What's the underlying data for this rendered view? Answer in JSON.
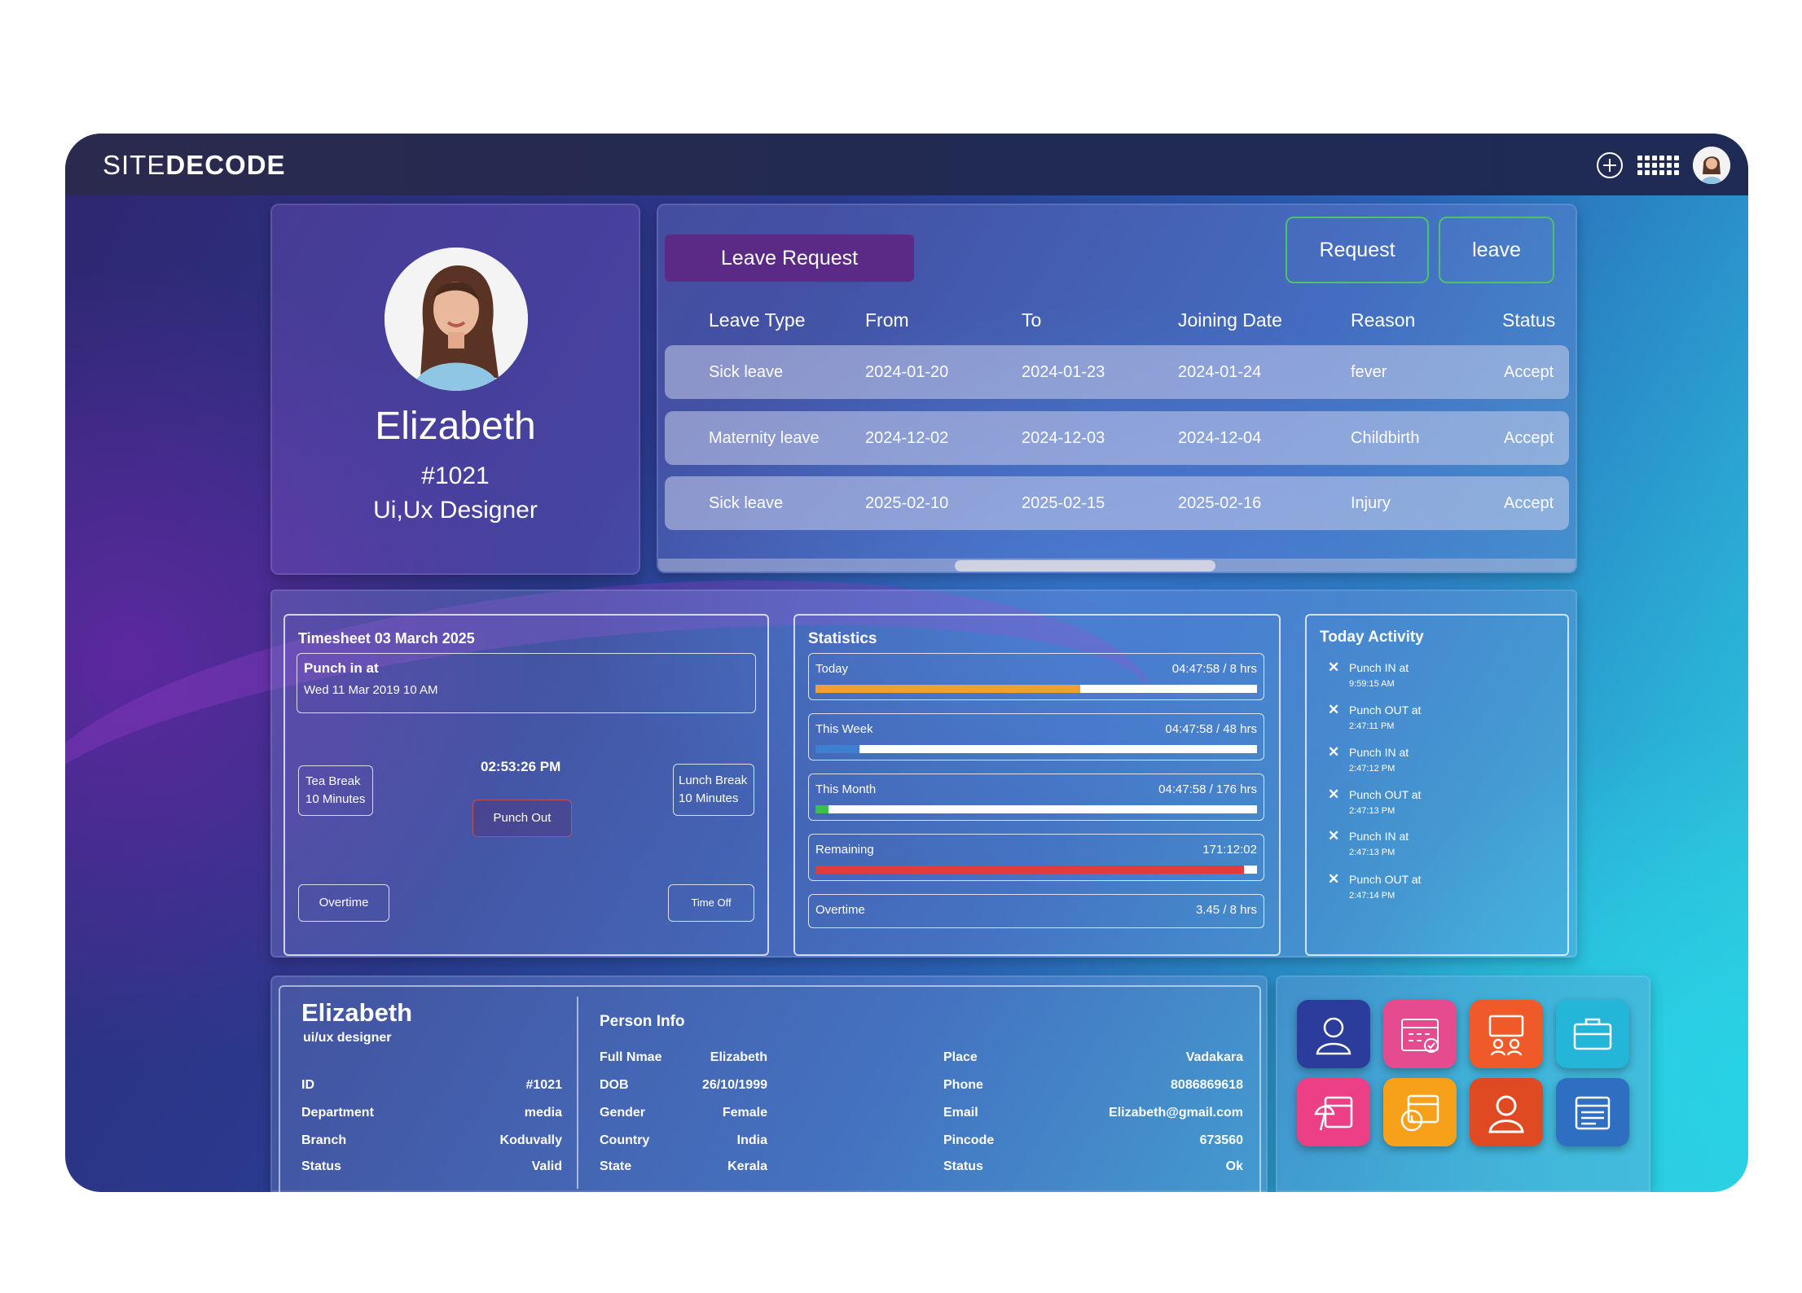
{
  "brand": {
    "prefix": "SITE",
    "suffix": "DECODE"
  },
  "profile": {
    "name": "Elizabeth",
    "id": "#1021",
    "role": "Ui,Ux Designer"
  },
  "leave": {
    "title": "Leave Request",
    "request_btn": "Request",
    "leave_btn": "leave",
    "headers": [
      "Leave Type",
      "From",
      "To",
      "Joining Date",
      "Reason",
      "Status"
    ],
    "rows": [
      [
        "Sick leave",
        "2024-01-20",
        "2024-01-23",
        "2024-01-24",
        "fever",
        "Accept"
      ],
      [
        "Maternity leave",
        "2024-12-02",
        "2024-12-03",
        "2024-12-04",
        "Childbirth",
        "Accept"
      ],
      [
        "Sick leave",
        "2025-02-10",
        "2025-02-15",
        "2025-02-16",
        "Injury",
        "Accept"
      ]
    ]
  },
  "timesheet": {
    "title": "Timesheet  03 March  2025",
    "punch_in_label": "Punch in at",
    "punch_in_value": "Wed 11 Mar 2019 10 AM",
    "timer": "02:53:26 PM",
    "tea_break_1": "Tea Break",
    "tea_break_2": "10 Minutes",
    "lunch_break_1": "Lunch Break",
    "lunch_break_2": "10 Minutes",
    "punch_out": "Punch Out",
    "overtime": "Overtime",
    "time_off": "Time Off"
  },
  "statistics": {
    "title": "Statistics",
    "rows": [
      {
        "label": "Today",
        "value": "04:47:58 / 8 hrs",
        "progress": 0.6,
        "color": "#f0a030"
      },
      {
        "label": "This Week",
        "value": "04:47:58 / 48 hrs",
        "progress": 0.1,
        "color": "#3f7fd0"
      },
      {
        "label": "This Month",
        "value": "04:47:58 / 176 hrs",
        "progress": 0.03,
        "color": "#3bbf4a"
      },
      {
        "label": "Remaining",
        "value": "171:12:02",
        "progress": 0.97,
        "color": "#e23b3b"
      },
      {
        "label": "Overtime",
        "value": "3.45 / 8 hrs"
      }
    ]
  },
  "activity": {
    "title": "Today Activity",
    "items": [
      {
        "label": "Punch IN at",
        "time": "9:59:15 AM"
      },
      {
        "label": "Punch OUT at",
        "time": "2:47:11 PM"
      },
      {
        "label": "Punch IN at",
        "time": "2:47:12 PM"
      },
      {
        "label": "Punch OUT at",
        "time": "2:47:13 PM"
      },
      {
        "label": "Punch IN at",
        "time": "2:47:13 PM"
      },
      {
        "label": "Punch OUT at",
        "time": "2:47:14 PM"
      }
    ]
  },
  "info": {
    "name": "Elizabeth",
    "role": "ui/ux designer",
    "left": [
      [
        "ID",
        "#1021"
      ],
      [
        "Department",
        "media"
      ],
      [
        "Branch",
        "Koduvally"
      ],
      [
        "Status",
        "Valid"
      ]
    ],
    "person_title": "Person Info",
    "mid": [
      [
        "Full Nmae",
        "Elizabeth"
      ],
      [
        "DOB",
        "26/10/1999"
      ],
      [
        "Gender",
        "Female"
      ],
      [
        "Country",
        "India"
      ],
      [
        "State",
        "Kerala"
      ]
    ],
    "right": [
      [
        "Place",
        "Vadakara"
      ],
      [
        "Phone",
        "8086869618"
      ],
      [
        "Email",
        "Elizabeth@gmail.com"
      ],
      [
        "Pincode",
        "673560"
      ],
      [
        "Status",
        "Ok"
      ]
    ]
  },
  "apps": [
    {
      "icon": "employee-icon",
      "color": "#2b3c9c"
    },
    {
      "icon": "calendar-check-icon",
      "color": "#e64b8f"
    },
    {
      "icon": "presentation-icon",
      "color": "#f05a28"
    },
    {
      "icon": "briefcase-icon",
      "color": "#23b6d8"
    },
    {
      "icon": "beach-calendar-icon",
      "color": "#ec3f85"
    },
    {
      "icon": "schedule-clock-icon",
      "color": "#f7a11a"
    },
    {
      "icon": "user-profile-icon",
      "color": "#e04a23"
    },
    {
      "icon": "payslip-icon",
      "color": "#2e6fc2"
    }
  ]
}
